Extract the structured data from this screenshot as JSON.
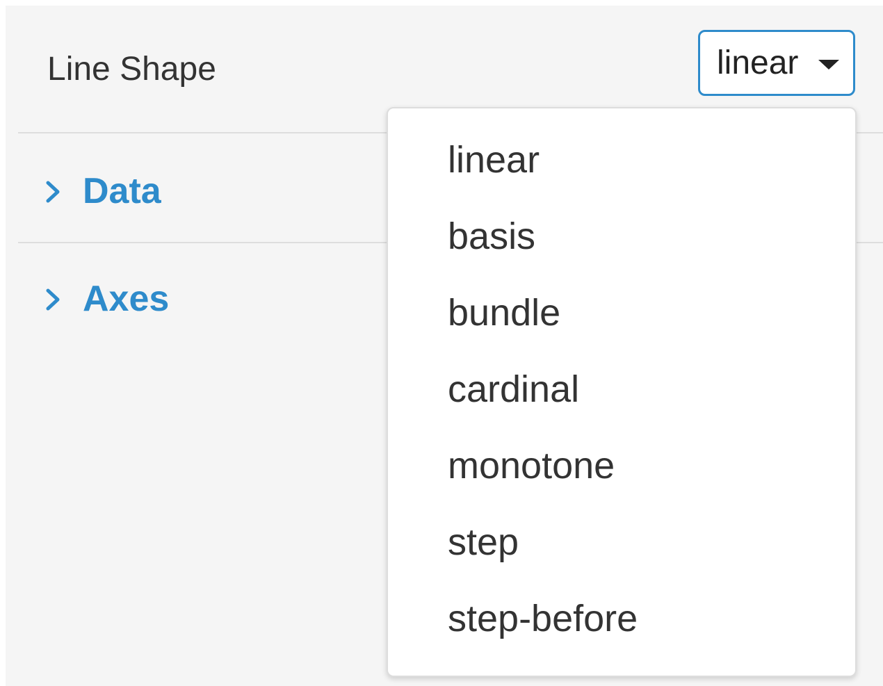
{
  "field": {
    "label": "Line Shape",
    "selected_value": "linear",
    "options": [
      "linear",
      "basis",
      "bundle",
      "cardinal",
      "monotone",
      "step",
      "step-before"
    ]
  },
  "sections": {
    "data": {
      "label": "Data",
      "icon": "chevron-right-icon"
    },
    "axes": {
      "label": "Axes",
      "icon": "chevron-right-icon"
    }
  },
  "colors": {
    "accent": "#2e8bcb",
    "panel_background": "#f5f5f5",
    "text": "#333333",
    "divider": "#dddddd"
  }
}
